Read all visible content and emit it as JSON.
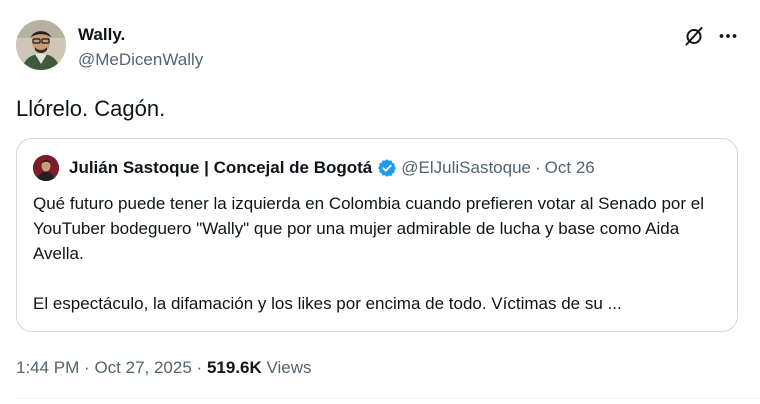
{
  "tweet": {
    "author": {
      "name": "Wally.",
      "handle": "@MeDicenWally",
      "avatar_icon": "profile-photo"
    },
    "text": "Llórelo. Cagón.",
    "quoted_post": {
      "author_name": "Julián Sastoque | Concejal de Bogotá",
      "author_handle": "@ElJuliSastoque",
      "separator": "·",
      "date": "Oct 26",
      "verified_icon": "verified-badge-icon",
      "verified_color": "#1d9bf0",
      "paragraph_1": "Qué futuro puede tener la izquierda en Colombia cuando prefieren votar al Senado por el YouTuber bodeguero \"Wally\" que por una mujer admirable de lucha y base como Aida Avella.",
      "paragraph_2": "El espectáculo, la difamación y los likes por encima de todo. Víctimas de su ..."
    },
    "meta": {
      "time": "1:44 PM",
      "separator": "·",
      "date": "Oct 27, 2025",
      "views_count": "519.6K",
      "views_label": "Views"
    }
  },
  "icons": {
    "grok": "grok-icon",
    "more": "more-options-icon"
  },
  "colors": {
    "text_primary": "#0f1419",
    "text_secondary": "#536471",
    "border": "#cfd9de",
    "accent_blue": "#1d9bf0"
  }
}
